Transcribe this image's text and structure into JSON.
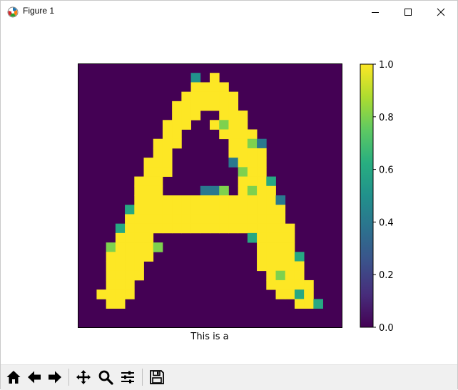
{
  "window": {
    "title": "Figure 1",
    "icons": {
      "app": "matplotlib-icon",
      "minimize": "minimize-icon",
      "maximize": "maximize-icon",
      "close": "close-icon"
    }
  },
  "figure": {
    "xlabel": "This is a"
  },
  "chart_data": {
    "type": "heatmap",
    "title": "",
    "xlabel": "This is a",
    "ylabel": "",
    "rows": 28,
    "cols": 28,
    "colormap": "viridis",
    "clim": [
      0.0,
      1.0
    ],
    "axis_ticks": false,
    "colorbar": {
      "ticks": [
        0.0,
        0.2,
        0.4,
        0.6,
        0.8,
        1.0
      ],
      "tick_labels": [
        "0.0",
        "0.2",
        "0.4",
        "0.6",
        "0.8",
        "1.0"
      ]
    },
    "cells": [
      [
        1,
        12,
        0.5
      ],
      [
        1,
        14,
        1
      ],
      [
        2,
        12,
        1
      ],
      [
        2,
        13,
        1
      ],
      [
        2,
        14,
        1
      ],
      [
        2,
        15,
        1
      ],
      [
        3,
        11,
        1
      ],
      [
        3,
        12,
        1
      ],
      [
        3,
        13,
        1
      ],
      [
        3,
        14,
        1
      ],
      [
        3,
        15,
        1
      ],
      [
        3,
        16,
        1
      ],
      [
        4,
        10,
        1
      ],
      [
        4,
        11,
        1
      ],
      [
        4,
        12,
        1
      ],
      [
        4,
        13,
        1
      ],
      [
        4,
        14,
        1
      ],
      [
        4,
        15,
        1
      ],
      [
        4,
        16,
        1
      ],
      [
        5,
        10,
        1
      ],
      [
        5,
        11,
        1
      ],
      [
        5,
        12,
        1
      ],
      [
        5,
        15,
        1
      ],
      [
        5,
        16,
        1
      ],
      [
        5,
        17,
        1
      ],
      [
        6,
        9,
        1
      ],
      [
        6,
        10,
        1
      ],
      [
        6,
        11,
        1
      ],
      [
        6,
        14,
        1
      ],
      [
        6,
        15,
        0.8
      ],
      [
        6,
        16,
        1
      ],
      [
        6,
        17,
        1
      ],
      [
        7,
        9,
        1
      ],
      [
        7,
        10,
        1
      ],
      [
        7,
        15,
        1
      ],
      [
        7,
        16,
        1
      ],
      [
        7,
        17,
        1
      ],
      [
        7,
        18,
        1
      ],
      [
        8,
        8,
        1
      ],
      [
        8,
        9,
        1
      ],
      [
        8,
        10,
        1
      ],
      [
        8,
        16,
        1
      ],
      [
        8,
        17,
        1
      ],
      [
        8,
        18,
        0.8
      ],
      [
        8,
        19,
        0.4
      ],
      [
        9,
        8,
        1
      ],
      [
        9,
        9,
        1
      ],
      [
        9,
        16,
        1
      ],
      [
        9,
        17,
        1
      ],
      [
        9,
        18,
        1
      ],
      [
        9,
        19,
        1
      ],
      [
        10,
        7,
        1
      ],
      [
        10,
        8,
        1
      ],
      [
        10,
        9,
        1
      ],
      [
        10,
        16,
        0.4
      ],
      [
        10,
        17,
        1
      ],
      [
        10,
        18,
        1
      ],
      [
        10,
        19,
        1
      ],
      [
        11,
        7,
        1
      ],
      [
        11,
        8,
        1
      ],
      [
        11,
        9,
        1
      ],
      [
        11,
        17,
        0.8
      ],
      [
        11,
        18,
        1
      ],
      [
        11,
        19,
        1
      ],
      [
        12,
        6,
        1
      ],
      [
        12,
        7,
        1
      ],
      [
        12,
        8,
        1
      ],
      [
        12,
        17,
        1
      ],
      [
        12,
        18,
        1
      ],
      [
        12,
        19,
        1
      ],
      [
        12,
        20,
        0.6
      ],
      [
        13,
        6,
        1
      ],
      [
        13,
        7,
        1
      ],
      [
        13,
        8,
        1
      ],
      [
        13,
        13,
        0.4
      ],
      [
        13,
        14,
        0.4
      ],
      [
        13,
        15,
        0.8
      ],
      [
        13,
        17,
        1
      ],
      [
        13,
        18,
        0.8
      ],
      [
        13,
        19,
        1
      ],
      [
        13,
        20,
        1
      ],
      [
        14,
        6,
        1
      ],
      [
        14,
        7,
        1
      ],
      [
        14,
        8,
        1
      ],
      [
        14,
        9,
        1
      ],
      [
        14,
        10,
        1
      ],
      [
        14,
        11,
        1
      ],
      [
        14,
        12,
        1
      ],
      [
        14,
        13,
        1
      ],
      [
        14,
        14,
        1
      ],
      [
        14,
        15,
        1
      ],
      [
        14,
        16,
        1
      ],
      [
        14,
        17,
        1
      ],
      [
        14,
        18,
        1
      ],
      [
        14,
        19,
        1
      ],
      [
        14,
        20,
        1
      ],
      [
        14,
        21,
        0.4
      ],
      [
        15,
        5,
        0.6
      ],
      [
        15,
        6,
        1
      ],
      [
        15,
        7,
        1
      ],
      [
        15,
        8,
        1
      ],
      [
        15,
        9,
        1
      ],
      [
        15,
        10,
        1
      ],
      [
        15,
        11,
        1
      ],
      [
        15,
        12,
        1
      ],
      [
        15,
        13,
        1
      ],
      [
        15,
        14,
        1
      ],
      [
        15,
        15,
        1
      ],
      [
        15,
        16,
        1
      ],
      [
        15,
        17,
        1
      ],
      [
        15,
        18,
        1
      ],
      [
        15,
        19,
        1
      ],
      [
        15,
        20,
        1
      ],
      [
        15,
        21,
        1
      ],
      [
        16,
        5,
        1
      ],
      [
        16,
        6,
        1
      ],
      [
        16,
        7,
        1
      ],
      [
        16,
        8,
        1
      ],
      [
        16,
        9,
        1
      ],
      [
        16,
        10,
        1
      ],
      [
        16,
        11,
        1
      ],
      [
        16,
        12,
        1
      ],
      [
        16,
        13,
        1
      ],
      [
        16,
        14,
        1
      ],
      [
        16,
        15,
        1
      ],
      [
        16,
        16,
        1
      ],
      [
        16,
        17,
        1
      ],
      [
        16,
        18,
        1
      ],
      [
        16,
        19,
        1
      ],
      [
        16,
        20,
        1
      ],
      [
        16,
        21,
        1
      ],
      [
        17,
        4,
        0.6
      ],
      [
        17,
        5,
        1
      ],
      [
        17,
        6,
        1
      ],
      [
        17,
        7,
        1
      ],
      [
        17,
        8,
        1
      ],
      [
        17,
        9,
        1
      ],
      [
        17,
        10,
        1
      ],
      [
        17,
        11,
        1
      ],
      [
        17,
        12,
        1
      ],
      [
        17,
        13,
        1
      ],
      [
        17,
        14,
        1
      ],
      [
        17,
        15,
        1
      ],
      [
        17,
        16,
        1
      ],
      [
        17,
        17,
        1
      ],
      [
        17,
        18,
        1
      ],
      [
        17,
        19,
        1
      ],
      [
        17,
        20,
        1
      ],
      [
        17,
        21,
        1
      ],
      [
        17,
        22,
        1
      ],
      [
        18,
        4,
        1
      ],
      [
        18,
        5,
        1
      ],
      [
        18,
        6,
        1
      ],
      [
        18,
        7,
        1
      ],
      [
        18,
        18,
        0.6
      ],
      [
        18,
        19,
        1
      ],
      [
        18,
        20,
        1
      ],
      [
        18,
        21,
        1
      ],
      [
        18,
        22,
        1
      ],
      [
        19,
        3,
        0.8
      ],
      [
        19,
        4,
        1
      ],
      [
        19,
        5,
        1
      ],
      [
        19,
        6,
        1
      ],
      [
        19,
        7,
        1
      ],
      [
        19,
        8,
        0.8
      ],
      [
        19,
        19,
        1
      ],
      [
        19,
        20,
        1
      ],
      [
        19,
        21,
        1
      ],
      [
        19,
        22,
        1
      ],
      [
        20,
        3,
        1
      ],
      [
        20,
        4,
        1
      ],
      [
        20,
        5,
        1
      ],
      [
        20,
        6,
        1
      ],
      [
        20,
        7,
        1
      ],
      [
        20,
        19,
        1
      ],
      [
        20,
        20,
        1
      ],
      [
        20,
        21,
        1
      ],
      [
        20,
        22,
        1
      ],
      [
        20,
        23,
        0.6
      ],
      [
        21,
        3,
        1
      ],
      [
        21,
        4,
        1
      ],
      [
        21,
        5,
        1
      ],
      [
        21,
        6,
        1
      ],
      [
        21,
        19,
        1
      ],
      [
        21,
        20,
        1
      ],
      [
        21,
        21,
        1
      ],
      [
        21,
        22,
        1
      ],
      [
        21,
        23,
        1
      ],
      [
        22,
        3,
        1
      ],
      [
        22,
        4,
        1
      ],
      [
        22,
        5,
        1
      ],
      [
        22,
        6,
        1
      ],
      [
        22,
        20,
        1
      ],
      [
        22,
        21,
        0.8
      ],
      [
        22,
        22,
        1
      ],
      [
        22,
        23,
        1
      ],
      [
        23,
        3,
        1
      ],
      [
        23,
        4,
        1
      ],
      [
        23,
        5,
        1
      ],
      [
        23,
        20,
        1
      ],
      [
        23,
        21,
        1
      ],
      [
        23,
        22,
        1
      ],
      [
        23,
        23,
        1
      ],
      [
        23,
        24,
        1
      ],
      [
        24,
        2,
        1
      ],
      [
        24,
        3,
        1
      ],
      [
        24,
        4,
        1
      ],
      [
        24,
        5,
        1
      ],
      [
        24,
        21,
        1
      ],
      [
        24,
        22,
        1
      ],
      [
        24,
        23,
        0.6
      ],
      [
        24,
        24,
        1
      ],
      [
        25,
        3,
        1
      ],
      [
        25,
        4,
        1
      ],
      [
        25,
        23,
        1
      ],
      [
        25,
        24,
        1
      ],
      [
        25,
        25,
        0.6
      ]
    ]
  },
  "toolbar": {
    "buttons": [
      {
        "name": "home-button",
        "icon": "home-icon"
      },
      {
        "name": "back-button",
        "icon": "arrow-left-icon"
      },
      {
        "name": "forward-button",
        "icon": "arrow-right-icon"
      },
      {
        "name": "pan-button",
        "icon": "move-icon"
      },
      {
        "name": "zoom-button",
        "icon": "magnifier-icon"
      },
      {
        "name": "subplots-button",
        "icon": "sliders-icon"
      },
      {
        "name": "save-button",
        "icon": "floppy-disk-icon"
      }
    ]
  }
}
